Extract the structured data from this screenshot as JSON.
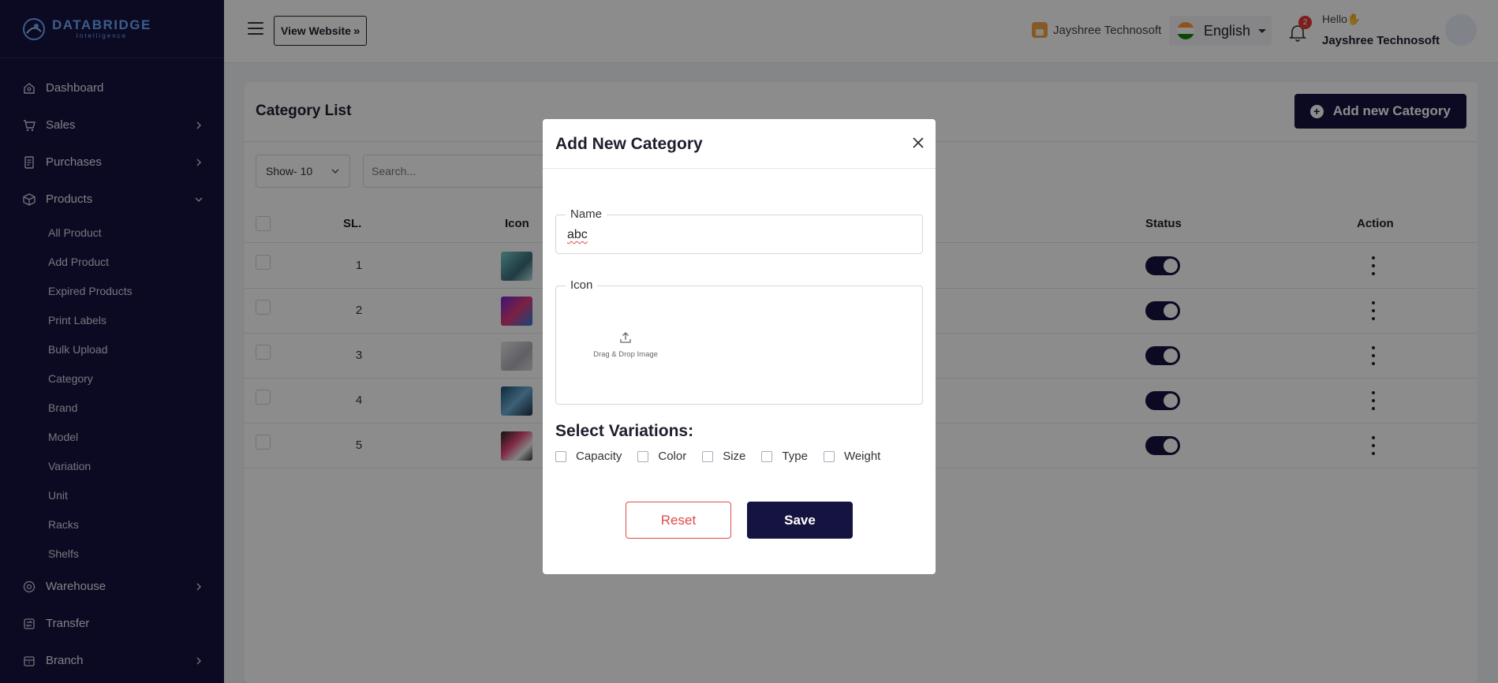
{
  "brand": {
    "title": "DATABRIDGE",
    "subtitle": "Intelligence"
  },
  "sidebar": {
    "items": [
      {
        "label": "Dashboard",
        "icon": "home-icon"
      },
      {
        "label": "Sales",
        "icon": "cart-icon"
      },
      {
        "label": "Purchases",
        "icon": "receipt-icon"
      },
      {
        "label": "Products",
        "icon": "box-icon"
      }
    ],
    "product_sub": [
      "All Product",
      "Add Product",
      "Expired Products",
      "Print Labels",
      "Bulk Upload",
      "Category",
      "Brand",
      "Model",
      "Variation",
      "Unit",
      "Racks",
      "Shelfs"
    ],
    "bottom_items": [
      {
        "label": "Warehouse",
        "icon": "warehouse-icon"
      },
      {
        "label": "Transfer",
        "icon": "transfer-icon"
      },
      {
        "label": "Branch",
        "icon": "branch-icon"
      }
    ]
  },
  "topbar": {
    "view_website": "View Website",
    "store_name": "Jayshree Technosoft",
    "language": "English",
    "notification_count": "2",
    "greeting": "Hello",
    "user_name": "Jayshree Technosoft"
  },
  "page": {
    "title": "Category List",
    "add_button": "Add new Category",
    "show_select": "Show- 10",
    "search_placeholder": "Search...",
    "columns": {
      "sl": "SL.",
      "icon": "Icon",
      "status": "Status",
      "action": "Action"
    },
    "rows": [
      {
        "sl": "1",
        "status": true
      },
      {
        "sl": "2",
        "status": true
      },
      {
        "sl": "3",
        "status": true
      },
      {
        "sl": "4",
        "status": true
      },
      {
        "sl": "5",
        "status": true
      }
    ]
  },
  "modal": {
    "title": "Add New Category",
    "name_label": "Name",
    "name_value": "abc",
    "icon_label": "Icon",
    "drop_text": "Drag & Drop Image",
    "variations_title": "Select Variations:",
    "variations": [
      "Capacity",
      "Color",
      "Size",
      "Type",
      "Weight"
    ],
    "reset_label": "Reset",
    "save_label": "Save"
  },
  "colors": {
    "primary": "#15133f",
    "danger": "#e04a4a",
    "overlay": "rgba(0,0,0,0.45)"
  }
}
